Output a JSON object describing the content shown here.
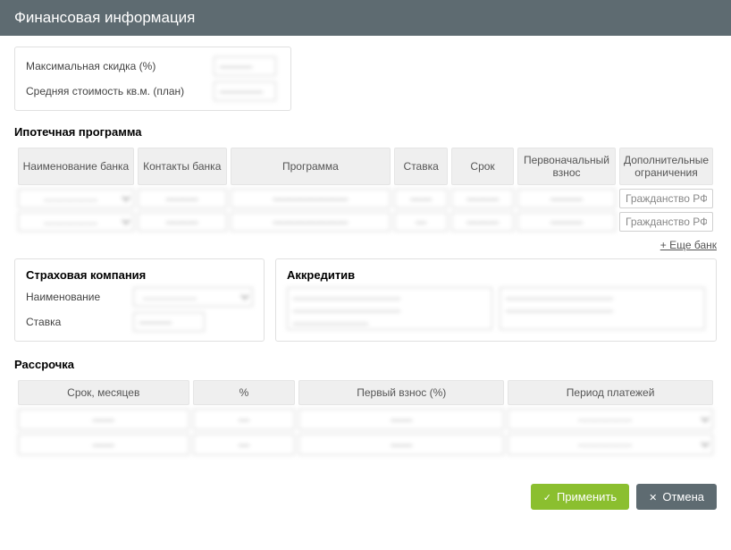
{
  "header": {
    "title": "Финансовая информация"
  },
  "top": {
    "maxDiscount": {
      "label": "Максимальная скидка (%)",
      "value": "———"
    },
    "avgPrice": {
      "label": "Средняя стоимость кв.м. (план)",
      "value": "————"
    }
  },
  "mortgage": {
    "title": "Ипотечная программа",
    "headers": [
      "Наименование банка",
      "Контакты банка",
      "Программа",
      "Ставка",
      "Срок",
      "Первоначальный взнос",
      "Дополнительные ограничения"
    ],
    "rows": [
      {
        "bank": "—————",
        "contacts": "———",
        "program": "———————",
        "rate": "——",
        "term": "———",
        "deposit": "———",
        "restrictions": "Гражданство РФ"
      },
      {
        "bank": "—————",
        "contacts": "———",
        "program": "———————",
        "rate": "—",
        "term": "———",
        "deposit": "———",
        "restrictions": "Гражданство РФ"
      }
    ],
    "addLink": "+ Еще банк"
  },
  "insurance": {
    "title": "Страховая компания",
    "nameLabel": "Наименование",
    "nameValue": "—————",
    "rateLabel": "Ставка",
    "rateValue": "———"
  },
  "akkreditiv": {
    "title": "Аккредитив",
    "left": "——————————\n——————————\n———————",
    "right": "——————————\n——————————"
  },
  "installment": {
    "title": "Рассрочка",
    "headers": [
      "Срок, месяцев",
      "%",
      "Первый взнос (%)",
      "Период платежей"
    ],
    "rows": [
      {
        "term": "——",
        "percent": "—",
        "first": "——",
        "period": "—————"
      },
      {
        "term": "——",
        "percent": "—",
        "first": "——",
        "period": "—————"
      }
    ]
  },
  "actions": {
    "apply": "Применить",
    "cancel": "Отмена"
  }
}
